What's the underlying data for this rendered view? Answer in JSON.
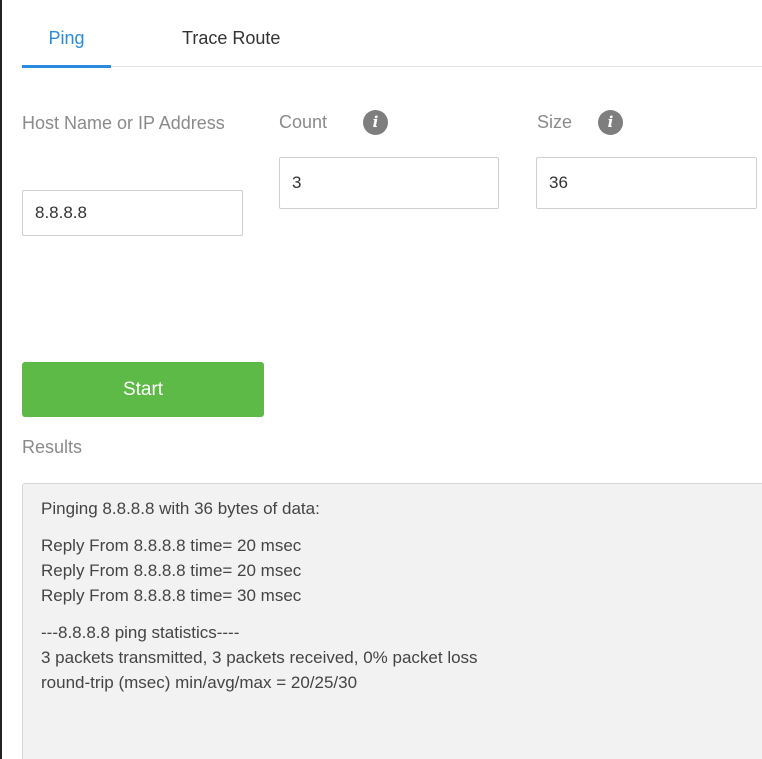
{
  "tabs": {
    "ping": "Ping",
    "trace_route": "Trace Route"
  },
  "form": {
    "host_label": "Host Name or IP Address",
    "host_value": "8.8.8.8",
    "count_label": "Count",
    "count_value": "3",
    "size_label": "Size",
    "size_value": "36",
    "info_glyph": "i"
  },
  "start_label": "Start",
  "results_label": "Results",
  "results": {
    "header": "Pinging 8.8.8.8 with 36 bytes of data:",
    "replies": [
      "Reply From 8.8.8.8 time= 20 msec",
      "Reply From 8.8.8.8 time= 20 msec",
      "Reply From 8.8.8.8 time= 30 msec"
    ],
    "stats_title": "---8.8.8.8 ping statistics----",
    "stats_packets": "3 packets transmitted, 3 packets received, 0% packet loss",
    "stats_rtt": "round-trip (msec) min/avg/max = 20/25/30"
  },
  "colors": {
    "accent": "#2a8ae0",
    "start_button": "#5dba46",
    "label_gray": "#8a8a8a",
    "results_bg": "#f2f2f2"
  },
  "icons": {
    "count_info": "info-icon",
    "size_info": "info-icon"
  }
}
